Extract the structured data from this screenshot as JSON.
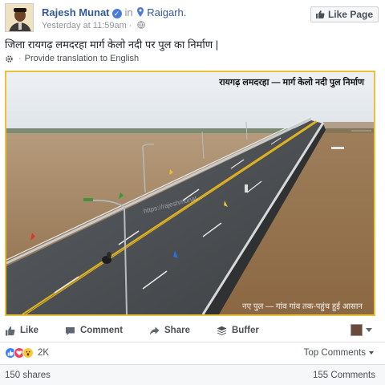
{
  "post": {
    "author": "Rajesh Munat",
    "in_text": "in",
    "place": "Raigarh.",
    "timestamp": "Yesterday at 11:59am",
    "like_page_label": "Like Page",
    "text": "जिला रायगढ़ लमदरहा मार्ग केलो नदी पर पुल का निर्माण |",
    "translate_label": "Provide translation to English",
    "photo": {
      "caption_top": "रायगढ़ लमदरहा — मार्ग केलो नदी पुल निर्माण",
      "caption_bottom": "नए पुल — गांव गांव तक-पहुंच हुई आसान",
      "watermark": "https://rajeshmunat..."
    }
  },
  "actions": {
    "like": "Like",
    "comment": "Comment",
    "share": "Share",
    "buffer": "Buffer"
  },
  "stats": {
    "reactions_count": "2K",
    "top_comments": "Top Comments",
    "shares": "150 shares",
    "comments": "155 Comments"
  },
  "colors": {
    "link": "#365899",
    "like_reaction": "#4080ff",
    "love_reaction": "#f33e58",
    "wow_reaction": "#fbc83a",
    "photo_border": "#e8c23c"
  }
}
